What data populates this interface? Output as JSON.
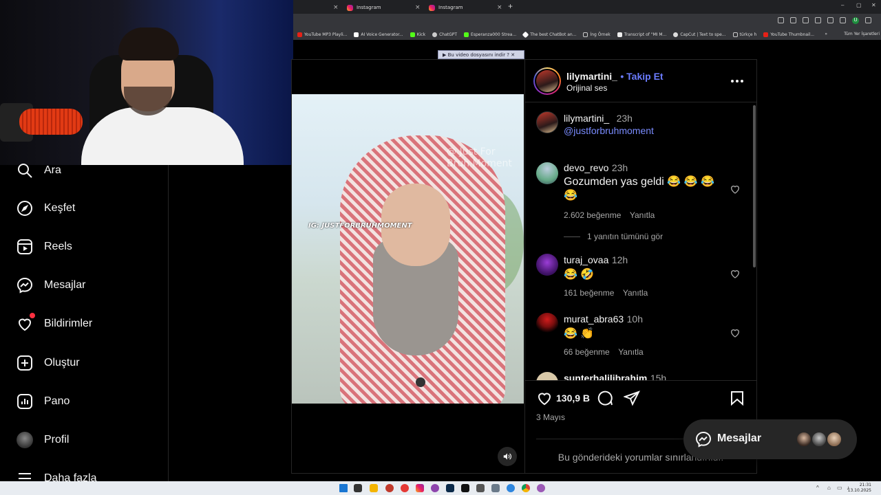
{
  "browser": {
    "tabs": [
      {
        "label": ""
      },
      {
        "label": "Instagram"
      },
      {
        "label": "Instagram"
      }
    ],
    "new_tab": "+",
    "window_controls": [
      "–",
      "▢",
      "✕"
    ],
    "bookmarks": [
      "YouTube MP3 Playli...",
      "AI Voice Generator...",
      "Kick",
      "ChatGPT",
      "Esperanza000 Strea...",
      "The best ChatBot an...",
      "İng Örnek",
      "Transcript of \"MI M...",
      "CapCut | Text to spe...",
      "türkçe h",
      "YouTube Thumbnail..."
    ],
    "bookmarks_more": "»",
    "bookmarks_all": "Tüm Yer İşaretleri",
    "download_bar": "▶ Bu video dosyasını indir  ? ✕",
    "profile_initial": "U"
  },
  "sidebar": {
    "items": [
      {
        "label": "Ara",
        "icon": "search-icon"
      },
      {
        "label": "Keşfet",
        "icon": "compass-icon"
      },
      {
        "label": "Reels",
        "icon": "reels-icon"
      },
      {
        "label": "Mesajlar",
        "icon": "messenger-icon"
      },
      {
        "label": "Bildirimler",
        "icon": "heart-icon"
      },
      {
        "label": "Oluştur",
        "icon": "plus-square-icon"
      },
      {
        "label": "Pano",
        "icon": "dashboard-icon"
      },
      {
        "label": "Profil",
        "icon": "profile-avatar"
      },
      {
        "label": "Daha fazla",
        "icon": "menu-icon"
      }
    ]
  },
  "video": {
    "watermark_left": "IG: JUSTFORBRUHMOMENT",
    "watermark_right": "@ Just For Bruh Moment"
  },
  "post": {
    "author": "lilymartini_",
    "follow": "• Takip Et",
    "audio": "Orijinal ses",
    "caption_author": "lilymartini_",
    "caption_time": "23h",
    "caption_text": "@justforbruhmoment",
    "comments": [
      {
        "user": "devo_revo",
        "time": "23h",
        "text": "Gozumden yas geldi 😂 😂 😂 😂",
        "likes": "2.602 beğenme",
        "reply": "Yanıtla",
        "view_replies": "1 yanıtın tümünü gör"
      },
      {
        "user": "turaj_ovaa",
        "time": "12h",
        "text": "😂 🤣",
        "likes": "161 beğenme",
        "reply": "Yanıtla"
      },
      {
        "user": "murat_abra63",
        "time": "10h",
        "text": "😂 👏",
        "likes": "66 beğenme",
        "reply": "Yanıtla"
      },
      {
        "user": "sunterhalilibrahim",
        "time": "15h"
      }
    ],
    "like_count": "130,9 B",
    "date": "3 Mayıs",
    "comments_limited": "Bu gönderideki yorumlar sınırlandırıldı."
  },
  "messages_pill": {
    "label": "Mesajlar"
  },
  "taskbar": {
    "time": "21:31",
    "date": "13.10.2025"
  },
  "colors": {
    "link": "#7a8cff",
    "follow": "#6b7cff",
    "notification": "#ff3040",
    "border": "#262626"
  }
}
